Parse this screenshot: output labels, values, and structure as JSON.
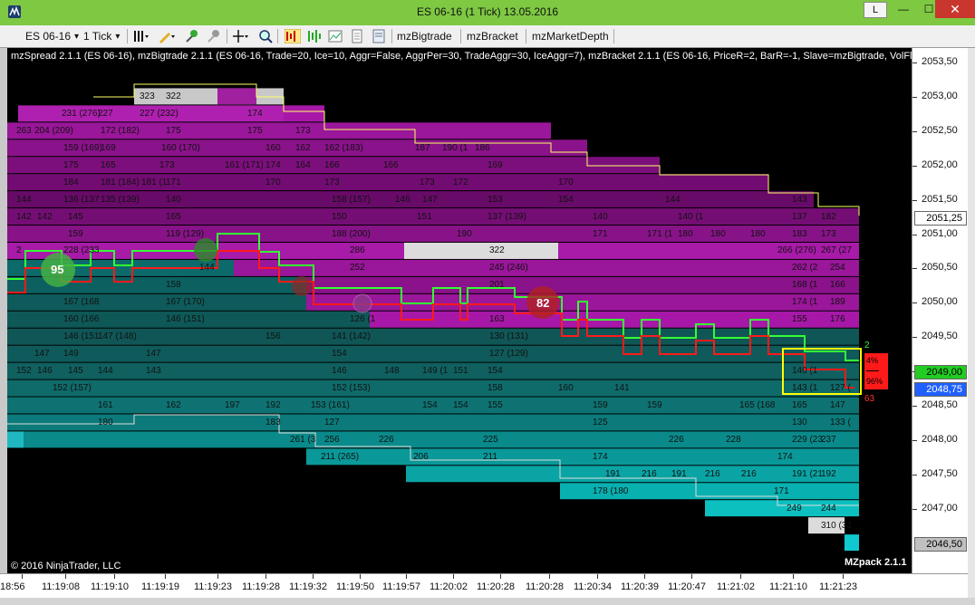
{
  "window": {
    "title": "ES 06-16 (1 Tick)  13.05.2016",
    "l_button": "L",
    "minimize_glyph": "—",
    "maximize_glyph": "☐",
    "close_glyph": "✕"
  },
  "toolbar": {
    "instrument": "ES 06-16",
    "interval": "1 Tick",
    "dropdown_glyph": "▾",
    "buttons": [
      "mzBigtrade",
      "mzBracket",
      "mzMarketDepth"
    ]
  },
  "chart": {
    "indicator_header": "mzSpread 2.1.1 (ES 06-16), mzBigtrade 2.1.1 (ES 06-16, Trade=20, Ice=10, Aggr=False, AggrPer=30, TradeAggr=30, IceAggr=7), mzBracket 2.1.1 (ES 06-16, PriceR=2, BarR=-1, Slave=mzBigtrade, VolFlt",
    "copyright": "© 2016 NinjaTrader, LLC",
    "brand": "MZpack 2.1.1",
    "bigtrade_labels": [
      "95",
      "82"
    ],
    "bracket_top_count": "2",
    "bracket_bottom_count": "63",
    "bracket_pct_top": "4%",
    "bracket_pct_bottom": "96%",
    "colors": {
      "background": "#000000",
      "bid_band": "#7a0a7a",
      "ask_band": "#0a6e6e",
      "bid_line": "#ff1a1a",
      "ask_line": "#33ff33",
      "bracket_box": "#ffff00",
      "title_bar": "#7ec842"
    },
    "depth_labels": [
      {
        "price": 2053.0,
        "texts": [
          [
            "323",
            146
          ],
          [
            "322",
            175
          ]
        ]
      },
      {
        "price": 2052.75,
        "texts": [
          [
            "231 (276)",
            60
          ],
          [
            "227",
            100
          ],
          [
            "227 (232)",
            146
          ],
          [
            "174",
            265
          ]
        ]
      },
      {
        "price": 2052.5,
        "texts": [
          [
            "263",
            10
          ],
          [
            "204 (209)",
            30
          ],
          [
            "172 (182)",
            103
          ],
          [
            "175",
            175
          ],
          [
            "175",
            265
          ],
          [
            "173",
            318
          ]
        ]
      },
      {
        "price": 2052.25,
        "texts": [
          [
            "159 (169)",
            62
          ],
          [
            "169",
            103
          ],
          [
            "160 (170)",
            170
          ],
          [
            "160",
            285
          ],
          [
            "162",
            318
          ],
          [
            "162 (183)",
            350
          ],
          [
            "187",
            450
          ],
          [
            "190 (1",
            480
          ],
          [
            "186",
            516
          ]
        ]
      },
      {
        "price": 2052.0,
        "texts": [
          [
            "175",
            62
          ],
          [
            "165",
            103
          ],
          [
            "173",
            168
          ],
          [
            "161 (171)",
            240
          ],
          [
            "174",
            285
          ],
          [
            "164",
            318
          ],
          [
            "166",
            350
          ],
          [
            "166",
            415
          ],
          [
            "169",
            530
          ]
        ]
      },
      {
        "price": 2051.75,
        "texts": [
          [
            "184",
            62
          ],
          [
            "181 (184)",
            103
          ],
          [
            "181 (1",
            148
          ],
          [
            "171",
            175
          ],
          [
            "170",
            285
          ],
          [
            "173",
            350
          ],
          [
            "173",
            455
          ],
          [
            "172",
            492
          ],
          [
            "170",
            608
          ]
        ]
      },
      {
        "price": 2051.5,
        "texts": [
          [
            "144",
            10
          ],
          [
            "136 (137",
            62
          ],
          [
            "135 (139)",
            103
          ],
          [
            "140",
            175
          ],
          [
            "158 (157)",
            358
          ],
          [
            "146",
            428
          ],
          [
            "147",
            458
          ],
          [
            "153",
            530
          ],
          [
            "154",
            608
          ],
          [
            "144",
            726
          ],
          [
            "143",
            866
          ]
        ]
      },
      {
        "price": 2051.25,
        "texts": [
          [
            "142",
            10
          ],
          [
            "142",
            33
          ],
          [
            "145",
            67
          ],
          [
            "165",
            175
          ],
          [
            "150",
            358
          ],
          [
            "151",
            452
          ],
          [
            "137 (139)",
            530
          ],
          [
            "140",
            646
          ],
          [
            "140 (1",
            740
          ],
          [
            "137",
            866
          ],
          [
            "182",
            898
          ]
        ]
      },
      {
        "price": 2051.0,
        "texts": [
          [
            "159",
            67
          ],
          [
            "119 (129)",
            175
          ],
          [
            "188 (200)",
            358
          ],
          [
            "190",
            496
          ],
          [
            "171",
            646
          ],
          [
            "171 (1",
            706
          ],
          [
            "180",
            740
          ],
          [
            "180",
            776
          ],
          [
            "180",
            820
          ],
          [
            "183",
            866
          ],
          [
            "173",
            898
          ]
        ]
      },
      {
        "price": 2050.75,
        "texts": [
          [
            "2",
            10
          ],
          [
            "228 (233",
            62
          ],
          [
            "286",
            378
          ],
          [
            "322",
            532
          ],
          [
            "266 (276)",
            850
          ],
          [
            "267 (27",
            898
          ]
        ]
      },
      {
        "price": 2050.5,
        "texts": [
          [
            "144",
            212
          ],
          [
            "252",
            378
          ],
          [
            "245 (246)",
            532
          ],
          [
            "262 (2",
            866
          ],
          [
            "254",
            908
          ]
        ]
      },
      {
        "price": 2050.25,
        "texts": [
          [
            "158",
            175
          ],
          [
            "201",
            532
          ],
          [
            "168 (1",
            866
          ],
          [
            "166",
            908
          ]
        ]
      },
      {
        "price": 2050.0,
        "texts": [
          [
            "167 (168",
            62
          ],
          [
            "167 (170)",
            175
          ],
          [
            "174 (1",
            866
          ],
          [
            "189",
            908
          ]
        ]
      },
      {
        "price": 2049.75,
        "texts": [
          [
            "160 (166",
            62
          ],
          [
            "146 (151)",
            175
          ],
          [
            "126 (1",
            378
          ],
          [
            "163",
            532
          ],
          [
            "155",
            866
          ],
          [
            "176",
            908
          ]
        ]
      },
      {
        "price": 2049.5,
        "texts": [
          [
            "146 (151",
            62
          ],
          [
            "147 (148)",
            100
          ],
          [
            "156",
            285
          ],
          [
            "141 (142)",
            358
          ],
          [
            "130 (131)",
            532
          ]
        ]
      },
      {
        "price": 2049.25,
        "texts": [
          [
            "147",
            30
          ],
          [
            "149",
            62
          ],
          [
            "147",
            153
          ],
          [
            "154",
            358
          ],
          [
            "127 (129)",
            532
          ]
        ]
      },
      {
        "price": 2049.0,
        "texts": [
          [
            "152",
            10
          ],
          [
            "146",
            33
          ],
          [
            "145",
            67
          ],
          [
            "144",
            100
          ],
          [
            "143",
            153
          ],
          [
            "146",
            358
          ],
          [
            "148",
            416
          ],
          [
            "149 (1",
            458
          ],
          [
            "151",
            492
          ],
          [
            "154",
            530
          ],
          [
            "140 (1",
            866
          ]
        ]
      },
      {
        "price": 2048.75,
        "texts": [
          [
            "152 (157)",
            50
          ],
          [
            "152 (153)",
            358
          ],
          [
            "158",
            530
          ],
          [
            "160",
            608
          ],
          [
            "141",
            670
          ],
          [
            "143 (1",
            866
          ],
          [
            "127 (",
            908
          ]
        ]
      },
      {
        "price": 2048.5,
        "texts": [
          [
            "161",
            100
          ],
          [
            "162",
            175
          ],
          [
            "197",
            240
          ],
          [
            "192",
            285
          ],
          [
            "153 (161)",
            335
          ],
          [
            "154",
            458
          ],
          [
            "154",
            492
          ],
          [
            "155",
            530
          ],
          [
            "159",
            646
          ],
          [
            "159",
            706
          ],
          [
            "165 (168",
            808
          ],
          [
            "165",
            866
          ],
          [
            "147",
            908
          ]
        ]
      },
      {
        "price": 2048.25,
        "texts": [
          [
            "180",
            100
          ],
          [
            "183",
            285
          ],
          [
            "127",
            350
          ],
          [
            "125",
            646
          ],
          [
            "130",
            866
          ],
          [
            "133 (",
            908
          ]
        ]
      },
      {
        "price": 2048.0,
        "texts": [
          [
            "261 (3",
            312
          ],
          [
            "256",
            350
          ],
          [
            "226",
            410
          ],
          [
            "225",
            525
          ],
          [
            "226",
            730
          ],
          [
            "228",
            793
          ],
          [
            "229 (23",
            866
          ],
          [
            "237",
            898
          ]
        ]
      },
      {
        "price": 2047.75,
        "texts": [
          [
            "211 (265)",
            346
          ],
          [
            "206",
            448
          ],
          [
            "211",
            525
          ],
          [
            "174",
            646
          ],
          [
            "174",
            850
          ]
        ]
      },
      {
        "price": 2047.5,
        "texts": [
          [
            "191",
            660
          ],
          [
            "216",
            700
          ],
          [
            "191",
            733
          ],
          [
            "216",
            770
          ],
          [
            "216",
            810
          ],
          [
            "191 (21",
            866
          ],
          [
            "192",
            898
          ]
        ]
      },
      {
        "price": 2047.25,
        "texts": [
          [
            "178 (180",
            646
          ],
          [
            "171",
            846
          ]
        ]
      },
      {
        "price": 2047.0,
        "texts": [
          [
            "249",
            860
          ],
          [
            "244",
            898
          ]
        ]
      },
      {
        "price": 2046.75,
        "texts": [
          [
            "310 (33",
            898
          ]
        ]
      }
    ]
  },
  "price_axis": {
    "labels": [
      "2053,50",
      "2053,00",
      "2052,50",
      "2052,00",
      "2051,50",
      "2051,00",
      "2050,50",
      "2050,00",
      "2049,50",
      "2049,00",
      "2048,50",
      "2048,00",
      "2047,50",
      "2047,00"
    ],
    "boxes": [
      {
        "text": "2051,25",
        "price": 2051.25,
        "bg": "#ffffff",
        "fg": "#000000"
      },
      {
        "text": "2049,00",
        "price": 2049.0,
        "bg": "#22cc22",
        "fg": "#000000"
      },
      {
        "text": "2048,75",
        "price": 2048.75,
        "bg": "#2060ff",
        "fg": "#ffffff"
      },
      {
        "text": "2046,50",
        "price": 2046.5,
        "bg": "#c0c0c0",
        "fg": "#000000"
      }
    ]
  },
  "time_axis": {
    "labels": [
      "18:56",
      "11:19:08",
      "11:19:10",
      "11:19:19",
      "11:19:23",
      "11:19:28",
      "11:19:32",
      "11:19:50",
      "11:19:57",
      "11:20:02",
      "11:20:28",
      "11:20:28",
      "11:20:34",
      "11:20:39",
      "11:20:47",
      "11:21:02",
      "11:21:10",
      "11:21:23"
    ]
  }
}
